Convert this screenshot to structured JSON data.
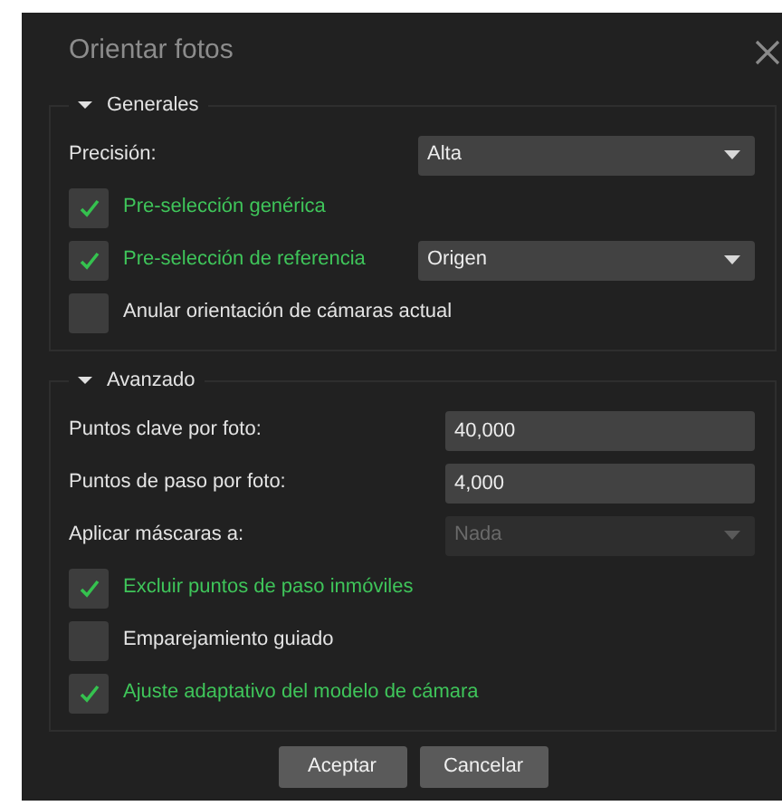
{
  "dialog": {
    "title": "Orientar fotos"
  },
  "groups": [
    {
      "title": "Generales",
      "expanded": true,
      "items": [
        {
          "kind": "combo",
          "label": "Precisión:",
          "value": "Alta",
          "disabled": false
        },
        {
          "kind": "checkbox",
          "label": "Pre-selección genérica",
          "checked": true
        },
        {
          "kind": "checkbox_combo",
          "label": "Pre-selección de referencia",
          "checked": true,
          "value": "Origen",
          "disabled": false
        },
        {
          "kind": "checkbox",
          "label": "Anular orientación de cámaras actual",
          "checked": false
        }
      ]
    },
    {
      "title": "Avanzado",
      "expanded": true,
      "items": [
        {
          "kind": "field",
          "label": "Puntos clave por foto:",
          "value": "40,000"
        },
        {
          "kind": "field",
          "label": "Puntos de paso por foto:",
          "value": "4,000"
        },
        {
          "kind": "combo",
          "label": "Aplicar máscaras a:",
          "value": "Nada",
          "disabled": true
        },
        {
          "kind": "checkbox",
          "label": "Excluir puntos de paso inmóviles",
          "checked": true
        },
        {
          "kind": "checkbox",
          "label": "Emparejamiento guiado",
          "checked": false
        },
        {
          "kind": "checkbox",
          "label": "Ajuste adaptativo del modelo de cámara",
          "checked": true
        }
      ]
    }
  ],
  "buttons": [
    "Aceptar",
    "Cancelar"
  ]
}
